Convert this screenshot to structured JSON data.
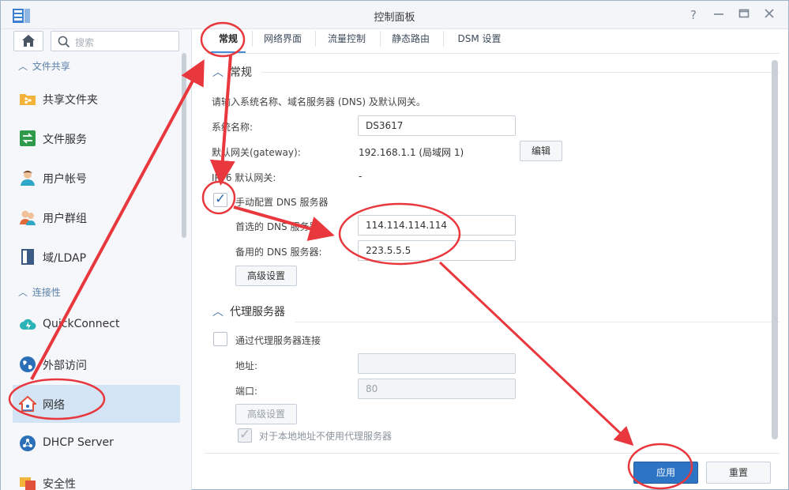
{
  "window": {
    "title": "控制面板"
  },
  "sidebar": {
    "search_placeholder": "搜索",
    "sections": [
      {
        "label": "文件共享"
      },
      {
        "label": "连接性"
      }
    ],
    "items": [
      {
        "label": "共享文件夹"
      },
      {
        "label": "文件服务"
      },
      {
        "label": "用户帐号"
      },
      {
        "label": "用户群组"
      },
      {
        "label": "域/LDAP"
      },
      {
        "label": "QuickConnect"
      },
      {
        "label": "外部访问"
      },
      {
        "label": "网络",
        "active": true
      },
      {
        "label": "DHCP Server"
      },
      {
        "label": "安全性"
      }
    ]
  },
  "tabs": [
    {
      "label": "常规",
      "active": true
    },
    {
      "label": "网络界面"
    },
    {
      "label": "流量控制"
    },
    {
      "label": "静态路由"
    },
    {
      "label": "DSM 设置"
    }
  ],
  "general": {
    "header": "常规",
    "description": "请输入系统名称、域名服务器 (DNS) 及默认网关。",
    "server_name_label": "系统名称:",
    "server_name_value": "DS3617",
    "gateway_label": "默认网关(gateway):",
    "gateway_value": "192.168.1.1 (局域网 1)",
    "edit_button": "编辑",
    "ipv6_label": "IPv6 默认网关:",
    "ipv6_value": "-",
    "manual_dns_label": "手动配置 DNS 服务器",
    "manual_dns_checked": true,
    "preferred_dns_label": "首选的 DNS 服务器:",
    "preferred_dns_value": "114.114.114.114",
    "alternate_dns_label": "备用的 DNS 服务器:",
    "alternate_dns_value": "223.5.5.5",
    "advanced_button": "高级设置"
  },
  "proxy": {
    "header": "代理服务器",
    "connect_label": "通过代理服务器连接",
    "connect_checked": false,
    "address_label": "地址:",
    "address_value": "",
    "port_label": "端口:",
    "port_value": "80",
    "advanced_button": "高级设置",
    "bypass_label": "对于本地地址不使用代理服务器",
    "bypass_checked": true
  },
  "footer": {
    "apply_button": "应用",
    "reset_button": "重置"
  },
  "colors": {
    "accent": "#2d74c4",
    "annotation": "#e8383d",
    "active_nav": "#d3e4f5"
  }
}
